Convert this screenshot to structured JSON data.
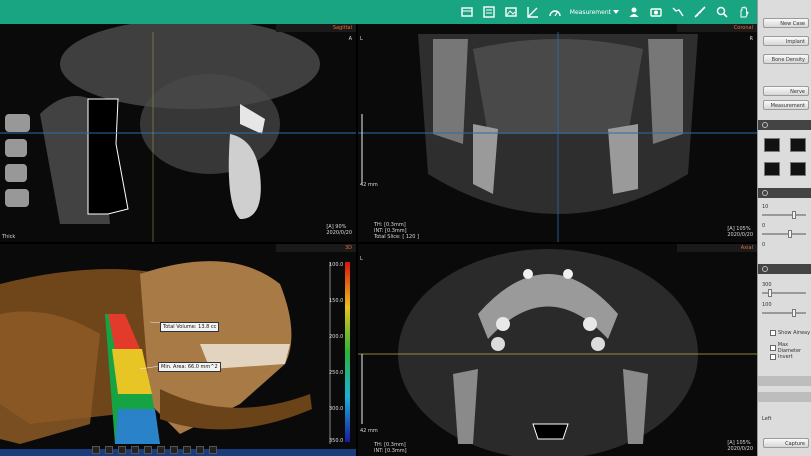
{
  "toolbar": {
    "measurement_dropdown": "Measurement",
    "colors": {
      "bar": "#1aa582",
      "icon": "#ffffff"
    }
  },
  "panes": {
    "sagittal": {
      "title": "Sagittal",
      "orientation": "A",
      "info_right": "[A] 90%\n2020/0/20",
      "info_left": "Thick",
      "icon": "sagittal-slice"
    },
    "coronal": {
      "title": "Coronal",
      "orientation_left": "L",
      "orientation_right": "R",
      "scale": "42 mm",
      "info_left": "TH: [0.3mm]\nINT: [0.3mm]\nTotal Slice: [ 120 ]",
      "info_right": "[A] 105%\n2020/0/20"
    },
    "volume3d": {
      "title": "3D",
      "colorbar_labels": [
        "100.0",
        "150.0",
        "200.0",
        "250.0",
        "300.0",
        "350.0"
      ],
      "callout_volume": "Total Volume: 13.8 cc",
      "callout_area": "Min. Area: 66.0 mm^2",
      "icon": "airway-volume"
    },
    "axial": {
      "title": "Axial",
      "orientation": "L",
      "scale": "42 mm",
      "info_left": "TH: [0.3mm]\nINT: [0.3mm]",
      "info_right": "[A] 105%\n2020/0/20"
    }
  },
  "side_panel": {
    "buttons": [
      "New Case",
      "Implant",
      "Bone Density",
      "Nerve",
      "Measurement",
      "Capture"
    ],
    "slider_values": [
      "10",
      "0",
      "0",
      "300",
      "100"
    ],
    "options": [
      "Show Airway",
      "Max Diameter",
      "Invert"
    ],
    "bottom_label": "Left"
  }
}
